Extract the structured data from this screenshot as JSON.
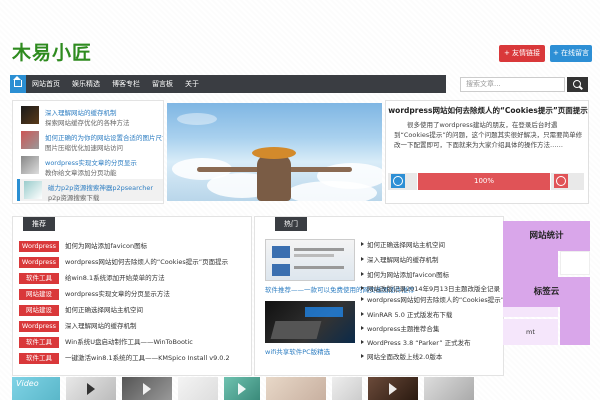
{
  "header": {
    "logo": "木易小匠",
    "btn_red": "+ 友情链接",
    "btn_blue": "+ 在线留言"
  },
  "nav": {
    "items": [
      "网站首页",
      "娱乐精选",
      "博客专栏",
      "留言板",
      "关于"
    ],
    "search_placeholder": "搜索文章..."
  },
  "toplist": [
    {
      "title": "深入理解网站的缓存机制",
      "sub": "探索网站缓存优化的各种方法"
    },
    {
      "title": "如何正确的为你的网站设置合适的图片尺寸--",
      "sub": "图片压缩优化加速网站访问"
    },
    {
      "title": "wordpress实现文章的分页显示",
      "sub": "教你给文章添加分页功能"
    },
    {
      "title": "磁力p2p资源搜索神器p2psearcher",
      "sub": "p2p资源搜索下载"
    }
  ],
  "article": {
    "title": "wordpress网站如何去除烦人的“Cookies提示”页面提示",
    "body": "　　很多使用了wordpress建站的朋友，在登录后台时遇到“Cookies提示”的问题，这个问题其实很好解决，只需要简单修改一下配置即可，下面就来为大家介绍具体的操作方法……",
    "vote_percent": "100%"
  },
  "left_panel": {
    "tab": "推荐",
    "rows": [
      {
        "tag": "Wordpress",
        "text": "如何为网站添加favicon图标"
      },
      {
        "tag": "Wordpress",
        "text": "wordpress网站如何去除烦人的“Cookies提示”页面提示"
      },
      {
        "tag": "软件工具",
        "text": "给win8.1系统添加开始菜单的方法"
      },
      {
        "tag": "网站建设",
        "text": "wordpress实现文章的分页显示方法"
      },
      {
        "tag": "网站建设",
        "text": "如何正确选择网站主机空间"
      },
      {
        "tag": "Wordpress",
        "text": "深入理解网站的缓存机制"
      },
      {
        "tag": "软件工具",
        "text": "Win系统U盘启动制作工具——WinToBootic"
      },
      {
        "tag": "软件工具",
        "text": "一键激活win8.1系统的工具——KMSpico Install v9.0.2"
      }
    ]
  },
  "mid_panel": {
    "tab": "热门",
    "captions": [
      "软件推荐——一款可以免费使用的网页截图插件推荐",
      "wifi共享软件PC版精选"
    ],
    "list": [
      "如何正确选择网站主机空间",
      "深入理解网站的缓存机制",
      "如何为网站添加favicon图标",
      "网站改版记录2014年9月13日主题改版全记录",
      "wordpress网站如何去除烦人的“Cookies提示”页面提示",
      "WinRAR 5.0 正式版发布下载",
      "wordpress主题推荐合集",
      "WordPress 3.8 “Parker” 正式发布",
      "网站全面改版上线2.0版本"
    ]
  },
  "calendar": {
    "head1": "网站统计",
    "head2": "标签云",
    "cell_text": "mt"
  },
  "strip": {
    "label": "Video"
  }
}
